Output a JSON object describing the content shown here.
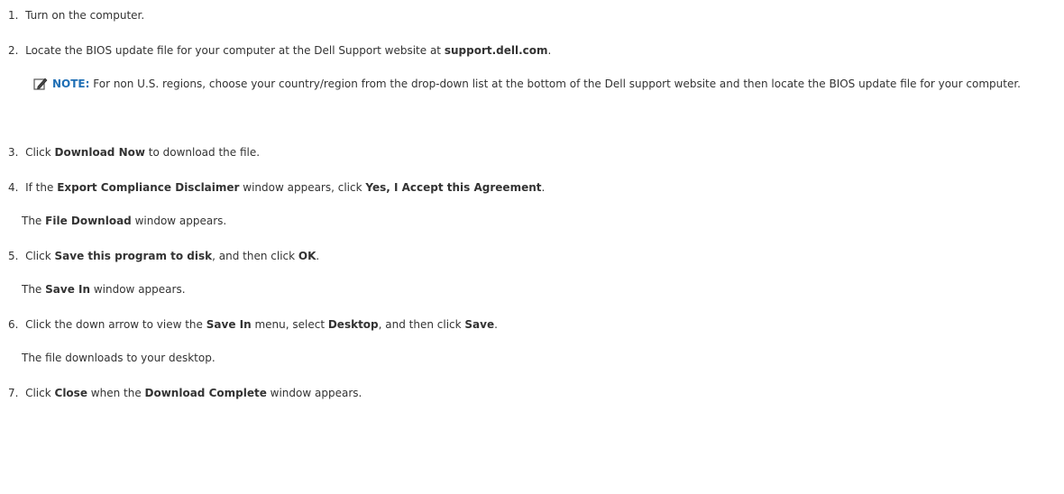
{
  "steps": [
    {
      "num": "1.",
      "parts": [
        "Turn on the computer."
      ]
    },
    {
      "num": "2.",
      "parts": [
        "Locate the BIOS update file for your computer at the Dell Support website at ",
        "support.dell.com",
        "."
      ]
    },
    {
      "num": "3.",
      "parts": [
        "Click ",
        "Download Now",
        " to download the file."
      ]
    },
    {
      "num": "4.",
      "parts": [
        "If the ",
        "Export Compliance Disclaimer",
        " window appears, click ",
        "Yes, I Accept this Agreement",
        "."
      ]
    },
    {
      "num": "5.",
      "parts": [
        "Click ",
        "Save this program to disk",
        ", and then click ",
        "OK",
        "."
      ]
    },
    {
      "num": "6.",
      "parts": [
        "Click the down arrow to view the ",
        "Save In",
        " menu, select ",
        "Desktop",
        ", and then click ",
        "Save",
        "."
      ]
    },
    {
      "num": "7.",
      "parts": [
        "Click ",
        "Close",
        " when the ",
        "Download Complete",
        " window appears."
      ]
    }
  ],
  "note": {
    "label": "NOTE:",
    "text": " For non U.S. regions, choose your country/region from the drop-down list at the bottom of the Dell support website and then locate the BIOS update file for your computer.",
    "icon": "pencil-note-icon"
  },
  "results": {
    "step4": [
      "The ",
      "File Download",
      " window appears."
    ],
    "step5": [
      "The ",
      "Save In",
      " window appears."
    ],
    "step6": [
      "The file downloads to your desktop."
    ]
  }
}
